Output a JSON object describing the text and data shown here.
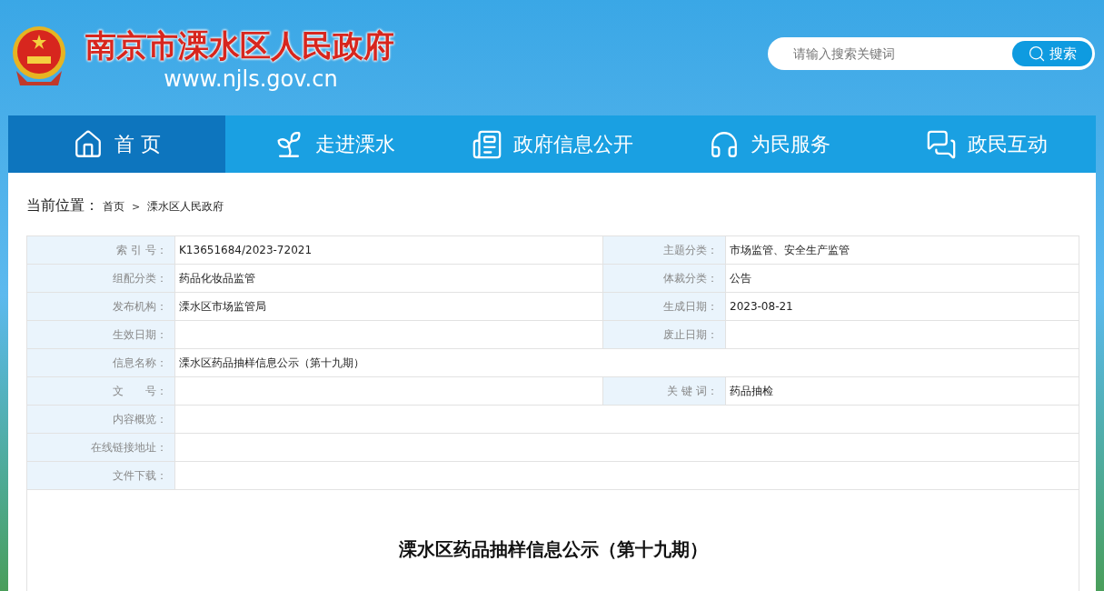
{
  "header": {
    "site_name": "南京市溧水区人民政府",
    "site_url": "www.njls.gov.cn",
    "search": {
      "placeholder": "请输入搜索关键词",
      "button": "搜索"
    }
  },
  "nav": [
    {
      "label": "首 页",
      "selected": true
    },
    {
      "label": "走进溧水",
      "selected": false
    },
    {
      "label": "政府信息公开",
      "selected": false
    },
    {
      "label": "为民服务",
      "selected": false
    },
    {
      "label": "政民互动",
      "selected": false
    }
  ],
  "breadcrumb": {
    "label": "当前位置：",
    "items": [
      "首页",
      "溧水区人民政府"
    ],
    "separator": ">"
  },
  "info_table": [
    {
      "cells": [
        {
          "label": "索 引 号：",
          "value": "K13651684/2023-72021"
        },
        {
          "label": "主题分类：",
          "value": "市场监管、安全生产监管"
        }
      ]
    },
    {
      "cells": [
        {
          "label": "组配分类：",
          "value": "药品化妆品监管"
        },
        {
          "label": "体裁分类：",
          "value": "公告"
        }
      ]
    },
    {
      "cells": [
        {
          "label": "发布机构：",
          "value": "溧水区市场监管局"
        },
        {
          "label": "生成日期：",
          "value": "2023-08-21"
        }
      ]
    },
    {
      "cells": [
        {
          "label": "生效日期："
        },
        {
          "label": "废止日期："
        }
      ]
    },
    {
      "cells": [
        {
          "label": "信息名称：",
          "value": "溧水区药品抽样信息公示（第十九期）"
        }
      ]
    },
    {
      "cells": [
        {
          "label": "文　　号："
        },
        {
          "label": "关 键 词：",
          "value": "药品抽检"
        }
      ]
    },
    {
      "cells": [
        {
          "label": "内容概览："
        }
      ]
    },
    {
      "cells": [
        {
          "label": "在线链接地址："
        }
      ]
    },
    {
      "cells": [
        {
          "label": "文件下载："
        }
      ]
    }
  ],
  "article": {
    "title": "溧水区药品抽样信息公示（第十九期）"
  }
}
